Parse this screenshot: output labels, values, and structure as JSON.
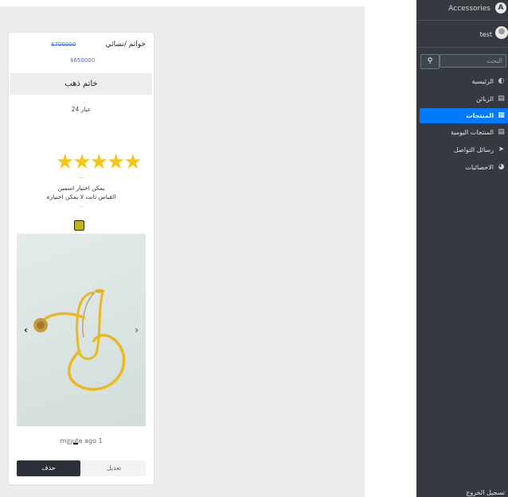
{
  "product": {
    "title": "خواتم /نسائي",
    "old_price": "$700000",
    "new_price": "$650000",
    "name": "خاتم ذهب",
    "karat": "عيار 24",
    "rating": 5,
    "description_line1": "يمكن اختيار اسمين",
    "description_line2": "القياس ثابت لا يمكن اختياره",
    "swatch_color": "#c2b21c",
    "time_ago": "minute ago 1",
    "delete_label": "حذف",
    "edit_label": "تعديل"
  },
  "sidebar": {
    "brand": "Accessories",
    "user_name": "test",
    "search_placeholder": "البحث",
    "items": [
      {
        "label": "الرئيسية",
        "icon": "dashboard-icon"
      },
      {
        "label": "الزبائن",
        "icon": "id-card-icon"
      },
      {
        "label": "المنتجات",
        "icon": "grid-icon",
        "active": true
      },
      {
        "label": "المنتجات اليومية",
        "icon": "list-icon"
      },
      {
        "label": "رسائل التواصل",
        "icon": "paper-plane-icon"
      },
      {
        "label": "الاحصائيات",
        "icon": "pie-chart-icon"
      }
    ],
    "logout": "تسجيل الخروج"
  },
  "colors": {
    "sidebar_bg": "#343a40",
    "active_item": "#007bff",
    "star": "#f5c518",
    "delete_button": "#2c3038"
  }
}
